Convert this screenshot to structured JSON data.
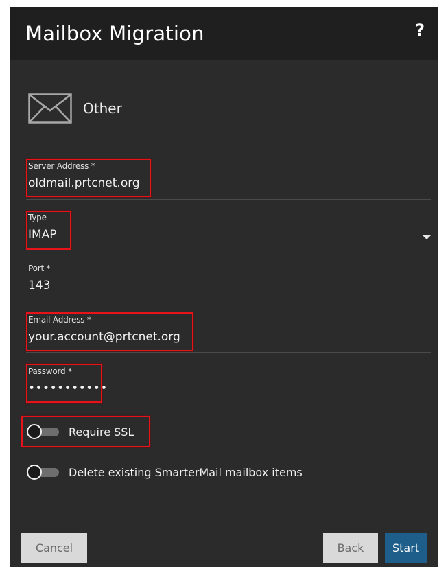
{
  "dialog": {
    "title": "Mailbox Migration",
    "help_label": "?"
  },
  "provider": {
    "icon": "envelope-icon",
    "label": "Other"
  },
  "fields": {
    "server": {
      "label": "Server Address *",
      "value": "oldmail.prtcnet.org"
    },
    "type": {
      "label": "Type",
      "value": "IMAP"
    },
    "port": {
      "label": "Port *",
      "value": "143"
    },
    "email": {
      "label": "Email Address *",
      "value": "your.account@prtcnet.org"
    },
    "password": {
      "label": "Password *",
      "value": "•••••••••••"
    }
  },
  "toggles": {
    "ssl": {
      "label": "Require SSL",
      "on": false
    },
    "delete": {
      "label": "Delete existing SmarterMail mailbox items",
      "on": false
    }
  },
  "buttons": {
    "cancel": "Cancel",
    "back": "Back",
    "start": "Start"
  },
  "colors": {
    "dialog_bg": "#2b2b2b",
    "header_bg": "#1f1f1f",
    "highlight": "#e8121b",
    "primary": "#1d5f8a",
    "secondary_btn": "#d9d9d9"
  }
}
